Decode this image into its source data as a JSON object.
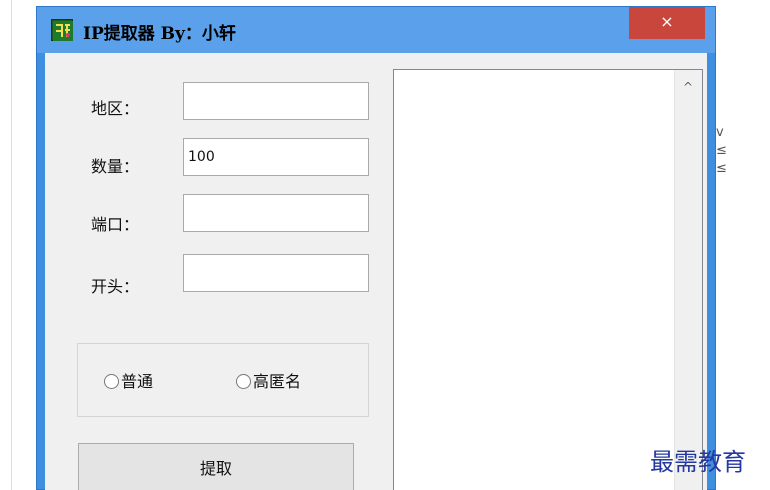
{
  "window": {
    "title": "IP提取器   By：小轩",
    "close_symbol": "×"
  },
  "form": {
    "region_label": "地区：",
    "region_value": "",
    "count_label": "数量：",
    "count_value": "100",
    "port_label": "端口：",
    "port_value": "",
    "prefix_label": "开头：",
    "prefix_value": ""
  },
  "options": {
    "normal_label": "普通",
    "high_anon_label": "高匿名",
    "selected": "none"
  },
  "actions": {
    "extract_label": "提取"
  },
  "output": {
    "text": "",
    "scroll_up_symbol": "^"
  },
  "background": {
    "right_marks": "v\n≤\n≤"
  },
  "watermark": {
    "text": "最需教育"
  },
  "colors": {
    "titlebar": "#5aa0ea",
    "window_border": "#3f8fe0",
    "close_button": "#c9463d",
    "client_bg": "#f0f0f0",
    "watermark": "#2438a0"
  },
  "icons": {
    "app": "app-icon",
    "close": "close-icon",
    "scroll_up": "scroll-up-arrow-icon"
  }
}
